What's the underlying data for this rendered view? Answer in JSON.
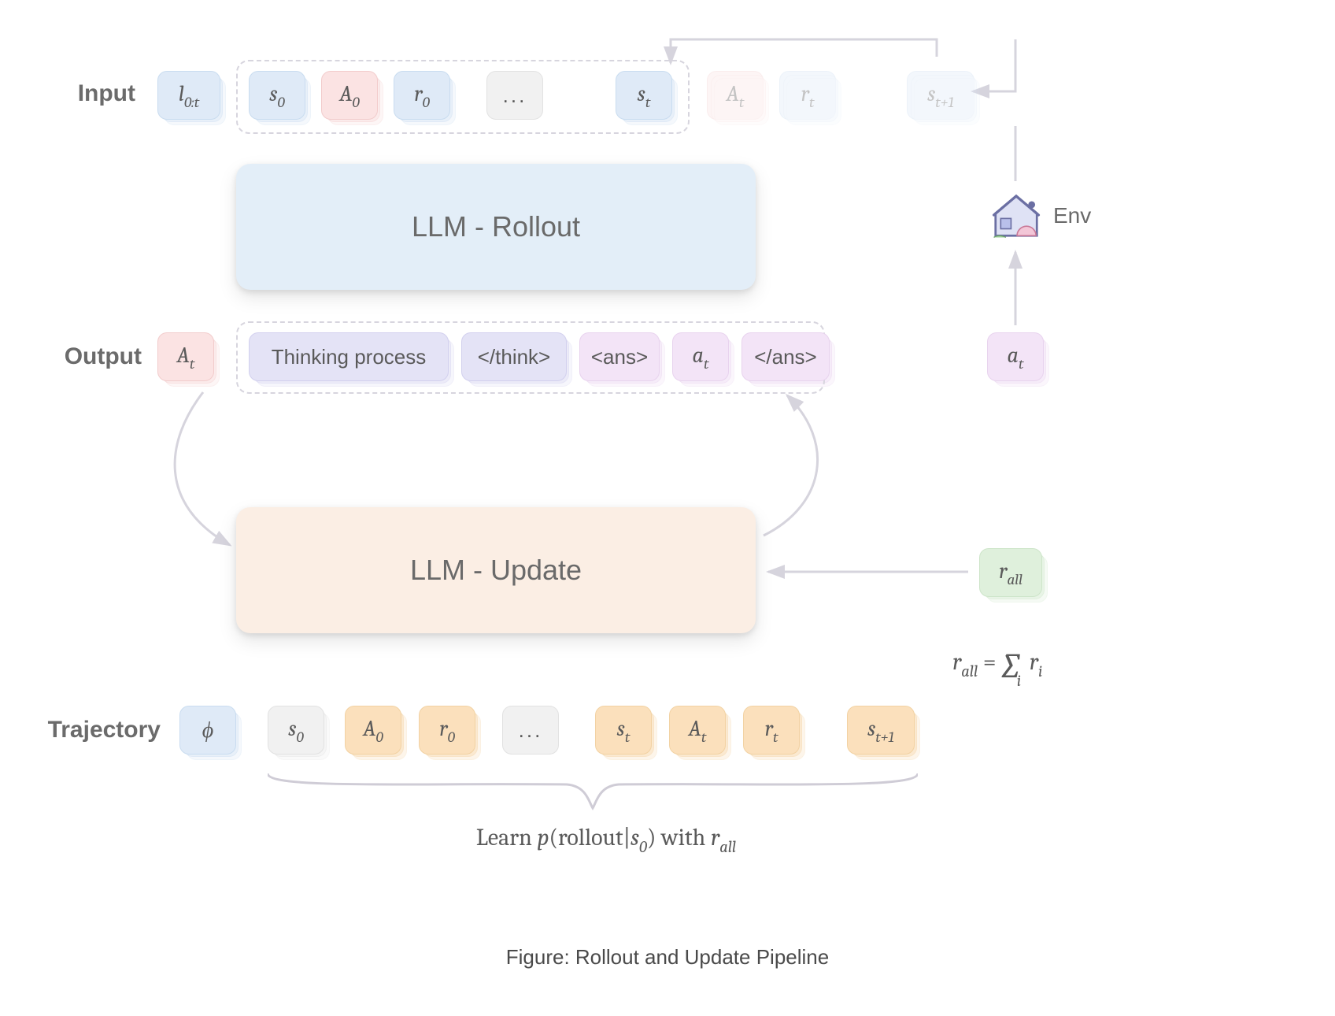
{
  "labels": {
    "input": "Input",
    "output": "Output",
    "trajectory": "Trajectory",
    "env": "Env"
  },
  "panels": {
    "rollout": "LLM - Rollout",
    "update": "LLM - Update"
  },
  "input_row": {
    "l": "l",
    "l_sub": "0:t",
    "s0": "s",
    "s0_sub": "0",
    "A0": "A",
    "A0_sub": "0",
    "r0": "r",
    "r0_sub": "0",
    "dots": "...",
    "st": "s",
    "st_sub": "t",
    "At": "A",
    "At_sub": "t",
    "rt": "r",
    "rt_sub": "t",
    "st1": "s",
    "st1_sub": "t+1"
  },
  "output_row": {
    "At": "A",
    "At_sub": "t",
    "thinking": "Thinking process",
    "think_close": "</think>",
    "ans_open": "<ans>",
    "a_t": "a",
    "a_t_sub": "t",
    "ans_close": "</ans>",
    "a_t_env": "a",
    "a_t_env_sub": "t"
  },
  "traj_row": {
    "phi": "ϕ",
    "s0": "s",
    "s0_sub": "0",
    "A0": "A",
    "A0_sub": "0",
    "r0": "r",
    "r0_sub": "0",
    "dots": "...",
    "st": "s",
    "st_sub": "t",
    "At": "A",
    "At_sub": "t",
    "rt": "r",
    "rt_sub": "t",
    "st1": "s",
    "st1_sub": "t+1"
  },
  "r_all": {
    "sym": "r",
    "sub": "all",
    "eq": "r",
    "eq_sub": "all",
    "sum": "∑",
    "sum_sub": "i",
    "ri": "r",
    "ri_sub": "i"
  },
  "learn": {
    "prefix": "Learn ",
    "p": "p",
    "open": "(",
    "rollout": "rollout",
    "bar": "|",
    "s0": "s",
    "s0_sub": "0",
    "close": ")",
    "with": " with ",
    "r": "r",
    "r_sub": "all"
  },
  "caption": "Figure: Rollout and Update Pipeline",
  "colors": {
    "blue": "#dfeaf7",
    "pink": "#fbe3e3",
    "violet": "#e4e3f6",
    "lilac": "#f3e4f7",
    "grey": "#f1f1f1",
    "orange": "#fbe0bc",
    "green": "#dff0dc"
  }
}
